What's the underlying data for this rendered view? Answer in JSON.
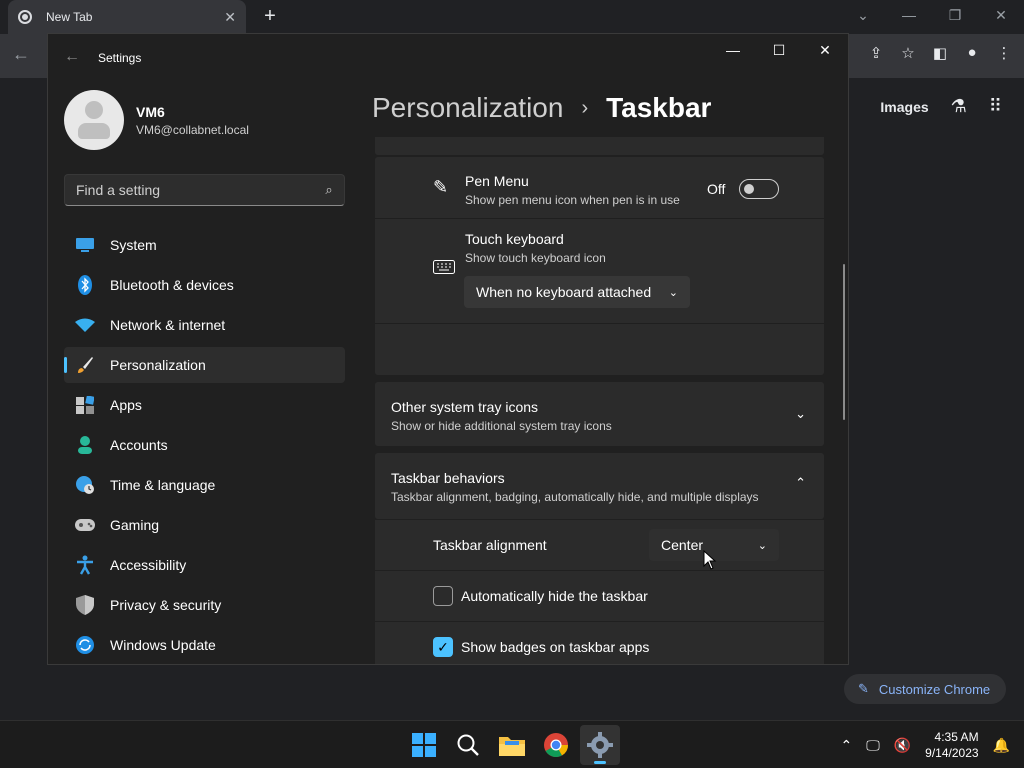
{
  "chrome": {
    "tab_title": "New Tab",
    "tab_close": "✕",
    "new_tab": "+",
    "images_link": "Images",
    "customize_label": "Customize Chrome"
  },
  "settings": {
    "window_title": "Settings",
    "user": {
      "name": "VM6",
      "email": "VM6@collabnet.local"
    },
    "search_placeholder": "Find a setting",
    "nav": [
      {
        "label": "System",
        "icon": "system-icon"
      },
      {
        "label": "Bluetooth & devices",
        "icon": "bluetooth-icon"
      },
      {
        "label": "Network & internet",
        "icon": "wifi-icon"
      },
      {
        "label": "Personalization",
        "icon": "brush-icon",
        "selected": true
      },
      {
        "label": "Apps",
        "icon": "apps-icon"
      },
      {
        "label": "Accounts",
        "icon": "person-icon"
      },
      {
        "label": "Time & language",
        "icon": "globe-clock-icon"
      },
      {
        "label": "Gaming",
        "icon": "gamepad-icon"
      },
      {
        "label": "Accessibility",
        "icon": "accessibility-icon"
      },
      {
        "label": "Privacy & security",
        "icon": "shield-icon"
      },
      {
        "label": "Windows Update",
        "icon": "update-icon"
      }
    ],
    "breadcrumb": {
      "parent": "Personalization",
      "separator": "›",
      "current": "Taskbar"
    },
    "pen_menu": {
      "title": "Pen Menu",
      "subtitle": "Show pen menu icon when pen is in use",
      "state_label": "Off"
    },
    "touch_keyboard": {
      "title": "Touch keyboard",
      "subtitle": "Show touch keyboard icon",
      "dropdown_value": "When no keyboard attached"
    },
    "other_tray": {
      "title": "Other system tray icons",
      "subtitle": "Show or hide additional system tray icons"
    },
    "behaviors": {
      "title": "Taskbar behaviors",
      "subtitle": "Taskbar alignment, badging, automatically hide, and multiple displays",
      "alignment_label": "Taskbar alignment",
      "alignment_value": "Center",
      "autohide_label": "Automatically hide the taskbar",
      "autohide_checked": false,
      "badges_label": "Show badges on taskbar apps",
      "badges_checked": true
    }
  },
  "taskbar": {
    "time": "4:35 AM",
    "date": "9/14/2023"
  },
  "colors": {
    "accent": "#4cc2ff",
    "window_bg": "#202020",
    "card_bg": "#2b2b2b"
  }
}
